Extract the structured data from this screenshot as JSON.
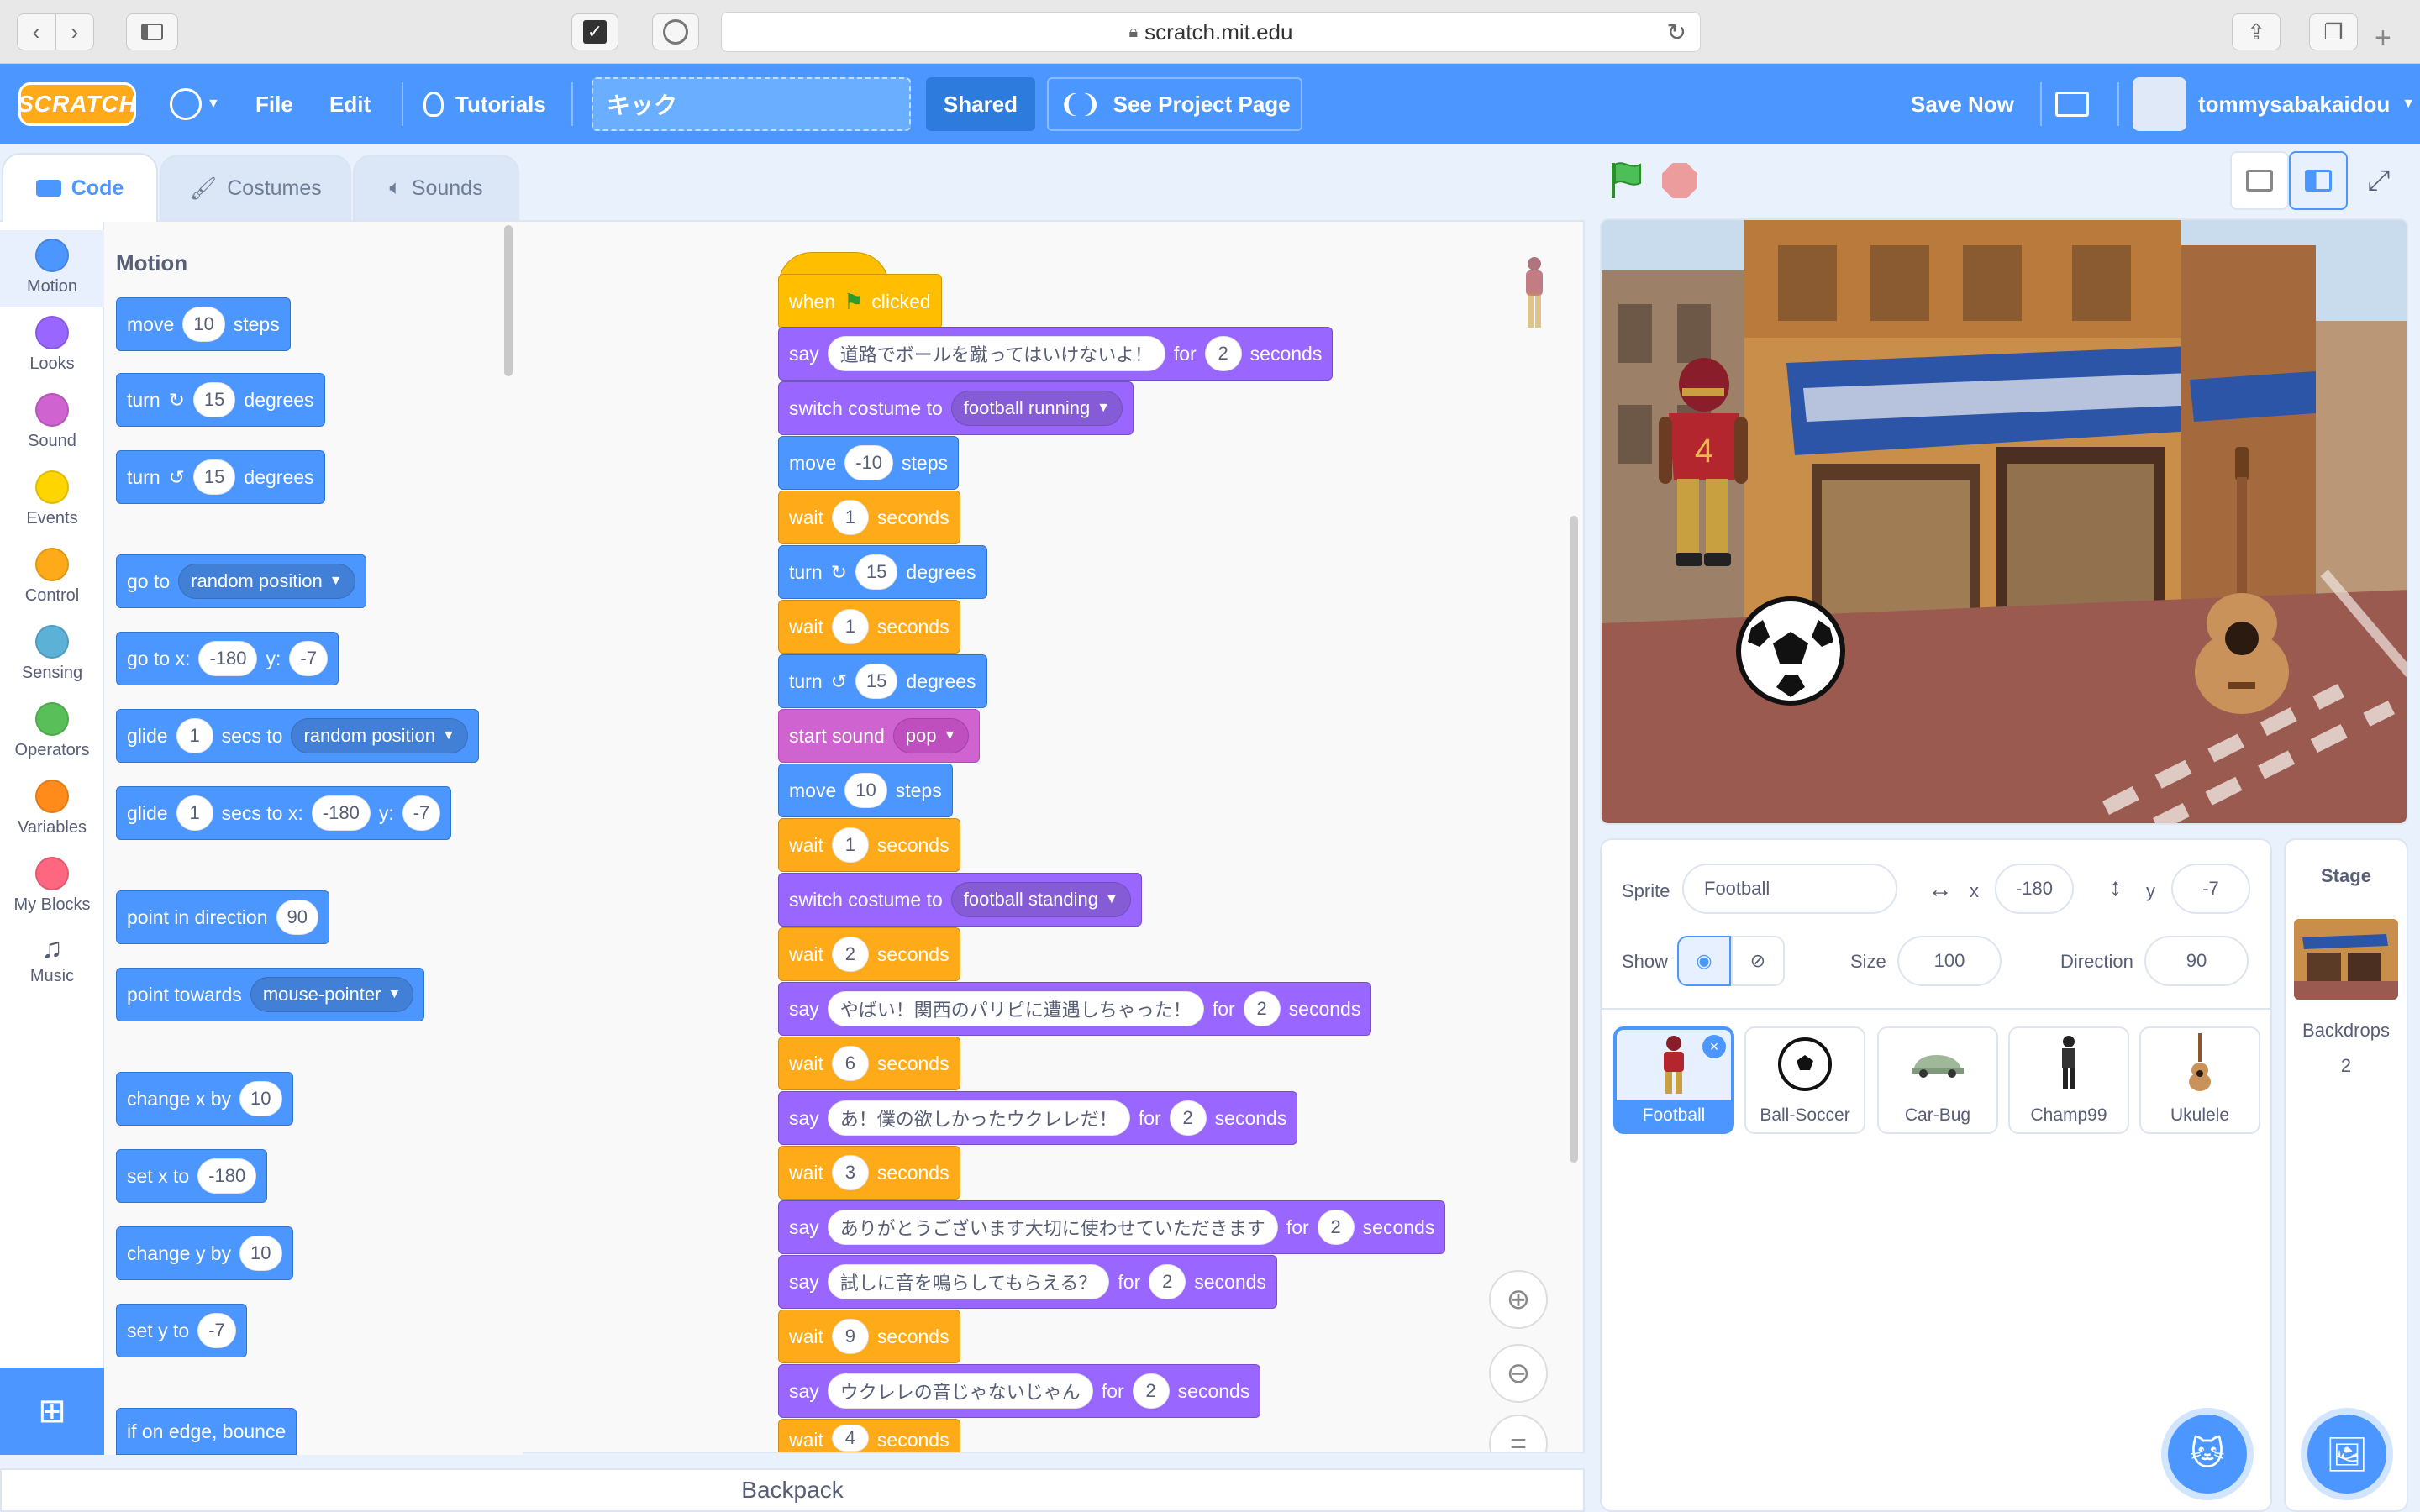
{
  "browser": {
    "url": "scratch.mit.edu"
  },
  "menu": {
    "file": "File",
    "edit": "Edit",
    "tutorials": "Tutorials",
    "project_title": "キック",
    "shared": "Shared",
    "see_project_page": "See Project Page",
    "save_now": "Save Now",
    "username": "tommysabakaidou",
    "logo": "SCRATCH"
  },
  "tabs": {
    "code": "Code",
    "costumes": "Costumes",
    "sounds": "Sounds"
  },
  "categories": [
    {
      "label": "Motion",
      "color": "#4c97ff"
    },
    {
      "label": "Looks",
      "color": "#9966ff"
    },
    {
      "label": "Sound",
      "color": "#cf63cf"
    },
    {
      "label": "Events",
      "color": "#ffd500"
    },
    {
      "label": "Control",
      "color": "#ffab19"
    },
    {
      "label": "Sensing",
      "color": "#5cb1d6"
    },
    {
      "label": "Operators",
      "color": "#59c059"
    },
    {
      "label": "Variables",
      "color": "#ff8c1a"
    },
    {
      "label": "My Blocks",
      "color": "#ff6680"
    },
    {
      "label": "Music",
      "color": "#0fbd8c"
    }
  ],
  "palette": {
    "heading": "Motion",
    "move": {
      "a": "move",
      "v": "10",
      "b": "steps"
    },
    "turn_cw": {
      "a": "turn",
      "v": "15",
      "b": "degrees"
    },
    "turn_ccw": {
      "a": "turn",
      "v": "15",
      "b": "degrees"
    },
    "goto": {
      "a": "go to",
      "dd": "random position"
    },
    "goto_xy": {
      "a": "go to x:",
      "x": "-180",
      "b": "y:",
      "y": "-7"
    },
    "glide": {
      "a": "glide",
      "v": "1",
      "b": "secs to",
      "dd": "random position"
    },
    "glide_xy": {
      "a": "glide",
      "v": "1",
      "b": "secs to x:",
      "x": "-180",
      "c": "y:",
      "y": "-7"
    },
    "point_dir": {
      "a": "point in direction",
      "v": "90"
    },
    "point_towards": {
      "a": "point towards",
      "dd": "mouse-pointer"
    },
    "change_x": {
      "a": "change x by",
      "v": "10"
    },
    "set_x": {
      "a": "set x to",
      "v": "-180"
    },
    "change_y": {
      "a": "change y by",
      "v": "10"
    },
    "set_y": {
      "a": "set y to",
      "v": "-7"
    },
    "bounce": {
      "a": "if on edge, bounce"
    }
  },
  "script": {
    "hat": {
      "a": "when",
      "b": "clicked"
    },
    "blocks": [
      {
        "a": "say",
        "t": "道路でボールを蹴ってはいけないよ！",
        "b": "for",
        "v": "2",
        "c": "seconds"
      },
      {
        "a": "switch costume to",
        "dd": "football running"
      },
      {
        "a": "move",
        "v": "-10",
        "b": "steps"
      },
      {
        "a": "wait",
        "v": "1",
        "b": "seconds"
      },
      {
        "a": "turn",
        "v": "15",
        "b": "degrees"
      },
      {
        "a": "wait",
        "v": "1",
        "b": "seconds"
      },
      {
        "a": "turn",
        "v": "15",
        "b": "degrees"
      },
      {
        "a": "start sound",
        "dd": "pop"
      },
      {
        "a": "move",
        "v": "10",
        "b": "steps"
      },
      {
        "a": "wait",
        "v": "1",
        "b": "seconds"
      },
      {
        "a": "switch costume to",
        "dd": "football standing"
      },
      {
        "a": "wait",
        "v": "2",
        "b": "seconds"
      },
      {
        "a": "say",
        "t": "やばい！関西のパリピに遭遇しちゃった！",
        "b": "for",
        "v": "2",
        "c": "seconds"
      },
      {
        "a": "wait",
        "v": "6",
        "b": "seconds"
      },
      {
        "a": "say",
        "t": "あ！僕の欲しかったウクレレだ！",
        "b": "for",
        "v": "2",
        "c": "seconds"
      },
      {
        "a": "wait",
        "v": "3",
        "b": "seconds"
      },
      {
        "a": "say",
        "t": "ありがとうございます大切に使わせていただきます",
        "b": "for",
        "v": "2",
        "c": "seconds"
      },
      {
        "a": "say",
        "t": "試しに音を鳴らしてもらえる？",
        "b": "for",
        "v": "2",
        "c": "seconds"
      },
      {
        "a": "wait",
        "v": "9",
        "b": "seconds"
      },
      {
        "a": "say",
        "t": "ウクレレの音じゃないじゃん",
        "b": "for",
        "v": "2",
        "c": "seconds"
      },
      {
        "a": "wait",
        "v": "4",
        "b": "seconds"
      }
    ]
  },
  "backpack": "Backpack",
  "sprite_info": {
    "sprite_label": "Sprite",
    "name": "Football",
    "x_label": "x",
    "x": "-180",
    "y_label": "y",
    "y": "-7",
    "show_label": "Show",
    "size_label": "Size",
    "size": "100",
    "direction_label": "Direction",
    "direction": "90"
  },
  "sprites": [
    "Football",
    "Ball-Soccer",
    "Car-Bug",
    "Champ99",
    "Ukulele"
  ],
  "stage_panel": {
    "title": "Stage",
    "backdrops_label": "Backdrops",
    "backdrops_count": "2"
  }
}
